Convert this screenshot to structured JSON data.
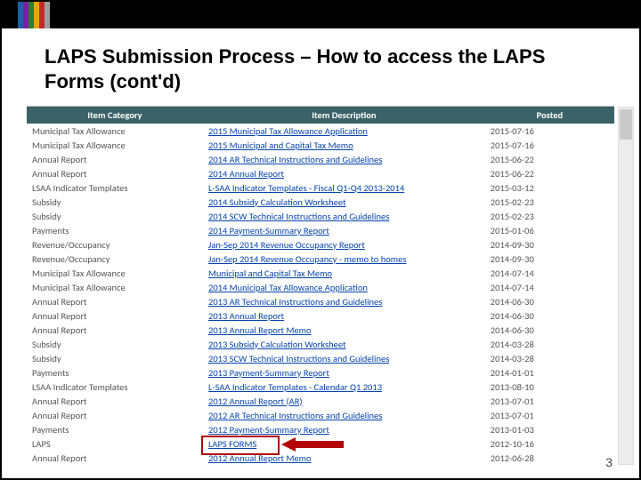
{
  "title": "LAPS Submission Process – How to access the LAPS Forms (cont'd)",
  "headers": {
    "cat": "Item Category",
    "desc": "Item Description",
    "date": "Posted"
  },
  "rows": [
    {
      "cat": "Municipal Tax Allowance",
      "desc": "2015 Municipal Tax Allowance Application",
      "date": "2015-07-16"
    },
    {
      "cat": "Municipal Tax Allowance",
      "desc": "2015 Municipal and Capital Tax Memo",
      "date": "2015-07-16"
    },
    {
      "cat": "Annual Report",
      "desc": "2014 AR Technical Instructions and Guidelines",
      "date": "2015-06-22"
    },
    {
      "cat": "Annual Report",
      "desc": "2014 Annual Report",
      "date": "2015-06-22"
    },
    {
      "cat": "LSAA Indicator Templates",
      "desc": "L-SAA Indicator Templates - Fiscal Q1-Q4 2013-2014",
      "date": "2015-03-12"
    },
    {
      "cat": "Subsidy",
      "desc": "2014 Subsidy Calculation Worksheet",
      "date": "2015-02-23"
    },
    {
      "cat": "Subsidy",
      "desc": "2014 SCW Technical Instructions and Guidelines",
      "date": "2015-02-23"
    },
    {
      "cat": "Payments",
      "desc": "2014 Payment-Summary Report",
      "date": "2015-01-06"
    },
    {
      "cat": "Revenue/Occupancy",
      "desc": "Jan-Sep 2014 Revenue Occupancy Report",
      "date": "2014-09-30"
    },
    {
      "cat": "Revenue/Occupancy",
      "desc": "Jan-Sep 2014 Revenue Occupancy - memo to homes",
      "date": "2014-09-30"
    },
    {
      "cat": "Municipal Tax Allowance",
      "desc": "Municipal and Capital Tax Memo",
      "date": "2014-07-14"
    },
    {
      "cat": "Municipal Tax Allowance",
      "desc": "2014 Municipal Tax Allowance Application",
      "date": "2014-07-14"
    },
    {
      "cat": "Annual Report",
      "desc": "2013 AR Technical Instructions and Guidelines",
      "date": "2014-06-30"
    },
    {
      "cat": "Annual Report",
      "desc": "2013 Annual Report",
      "date": "2014-06-30"
    },
    {
      "cat": "Annual Report",
      "desc": "2013 Annual Report Memo",
      "date": "2014-06-30"
    },
    {
      "cat": "Subsidy",
      "desc": "2013 Subsidy Calculation Worksheet",
      "date": "2014-03-28"
    },
    {
      "cat": "Subsidy",
      "desc": "2013 SCW Technical Instructions and Guidelines",
      "date": "2014-03-28"
    },
    {
      "cat": "Payments",
      "desc": "2013 Payment-Summary Report",
      "date": "2014-01-01"
    },
    {
      "cat": "LSAA Indicator Templates",
      "desc": "L-SAA Indicator Templates - Calendar Q1 2013",
      "date": "2013-08-10"
    },
    {
      "cat": "Annual Report",
      "desc": "2012 Annual Report (AR)",
      "date": "2013-07-01"
    },
    {
      "cat": "Annual Report",
      "desc": "2012 AR Technical Instructions and Guidelines",
      "date": "2013-07-01"
    },
    {
      "cat": "Payments",
      "desc": "2012 Payment-Summary Report",
      "date": "2013-01-03"
    },
    {
      "cat": "LAPS",
      "desc": "LAPS FORMS",
      "date": "2012-10-16"
    },
    {
      "cat": "Annual Report",
      "desc": "2012 Annual Report Memo",
      "date": "2012-06-28"
    }
  ],
  "highlight_row_index": 22,
  "page_number": "3"
}
